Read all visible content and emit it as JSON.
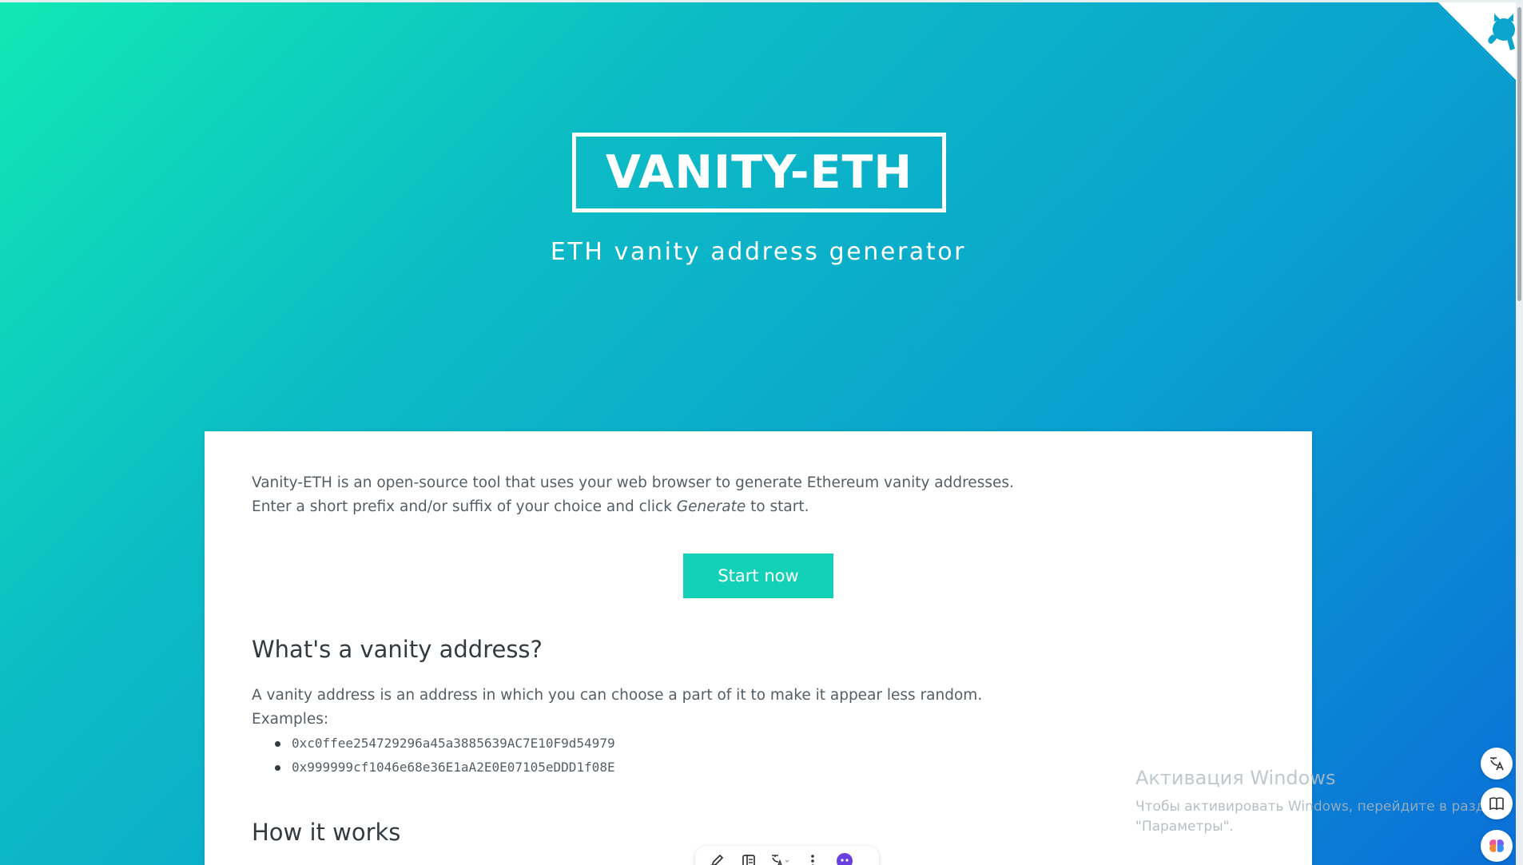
{
  "hero": {
    "title": "VANITY-ETH",
    "subtitle": "ETH vanity address generator"
  },
  "intro": {
    "line1": "Vanity-ETH is an open-source tool that uses your web browser to generate Ethereum vanity addresses.",
    "line2_before": "Enter a short prefix and/or suffix of your choice and click ",
    "line2_emphasis": "Generate",
    "line2_after": " to start."
  },
  "start_button": {
    "label": "Start now"
  },
  "vanity_section": {
    "heading": "What's a vanity address?",
    "description": "A vanity address is an address in which you can choose a part of it to make it appear less random.",
    "examples_label": "Examples:",
    "examples": [
      "0xc0ffee254729296a45a3885639AC7E10F9d54979",
      "0x999999cf1046e68e36E1aA2E0E07105eDDD1f08E"
    ]
  },
  "how_section": {
    "heading": "How it works"
  },
  "watermark": {
    "title": "Активация Windows",
    "line1": "Чтобы активировать Windows, перейдите в раздел",
    "line2": "\"Параметры\"."
  },
  "icons": {
    "github_corner": "github-octocat-icon",
    "float_1": "translate-icon",
    "float_2": "book-icon",
    "float_3": "brain-icon",
    "toolbar": [
      "highlighter-icon",
      "sidebar-icon",
      "translate-icon",
      "more-icon",
      "assistant-icon"
    ]
  },
  "colors": {
    "gradient_start": "#11e8b4",
    "gradient_end": "#0a6fd8",
    "button": "#13d1b7",
    "assistant": "#6a3fe0"
  }
}
